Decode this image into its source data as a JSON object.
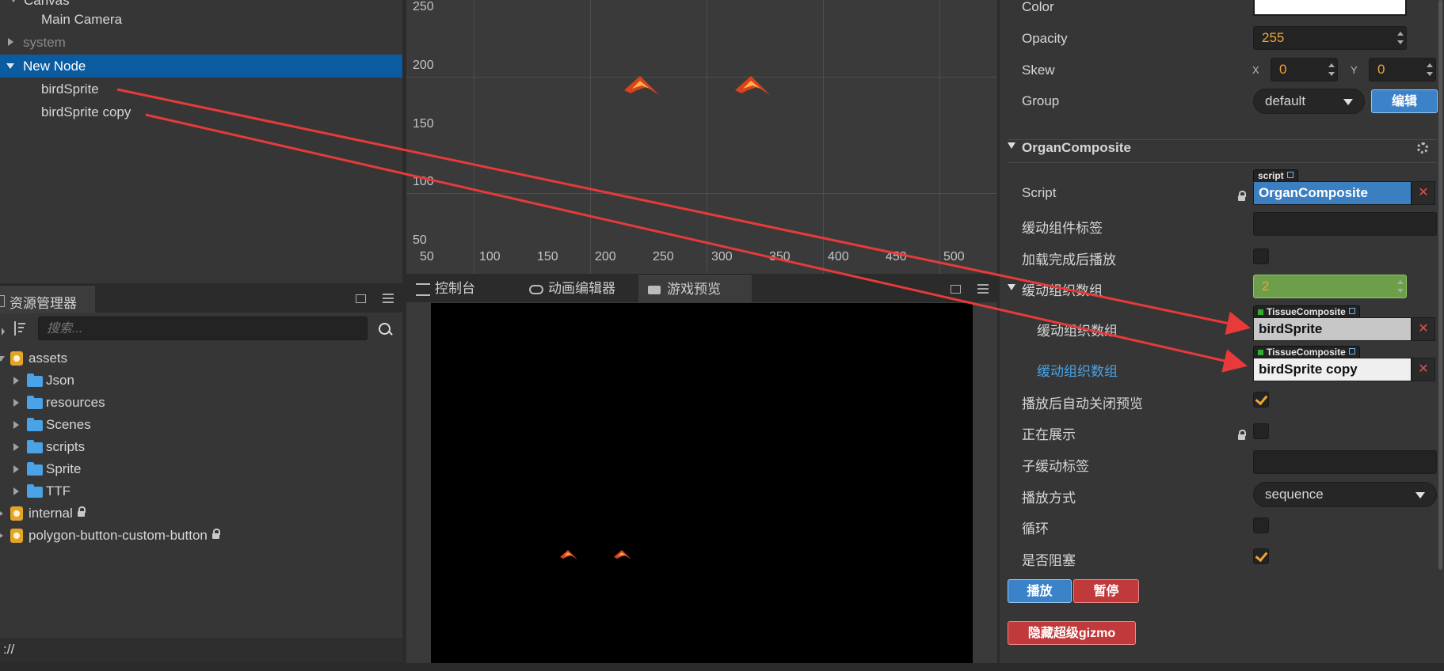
{
  "hierarchy": {
    "items": [
      {
        "label": "Canvas"
      },
      {
        "label": "Main Camera"
      },
      {
        "label": "system"
      },
      {
        "label": "New Node"
      },
      {
        "label": "birdSprite"
      },
      {
        "label": "birdSprite copy"
      }
    ]
  },
  "assets": {
    "tab_label": "资源管理器",
    "search_placeholder": "搜索...",
    "tree": [
      {
        "label": "assets"
      },
      {
        "label": "Json"
      },
      {
        "label": "resources"
      },
      {
        "label": "Scenes"
      },
      {
        "label": "scripts"
      },
      {
        "label": "Sprite"
      },
      {
        "label": "TTF"
      },
      {
        "label": "internal"
      },
      {
        "label": "polygon-button-custom-button"
      }
    ],
    "status": "://"
  },
  "scene": {
    "y_ticks": [
      "250",
      "200",
      "150",
      "100",
      "50"
    ],
    "x_ticks": [
      "50",
      "100",
      "150",
      "200",
      "250",
      "300",
      "350",
      "400",
      "450",
      "500"
    ]
  },
  "bottom_tabs": {
    "console": "控制台",
    "anim_editor": "动画编辑器",
    "game_preview": "游戏预览"
  },
  "inspector": {
    "color_label": "Color",
    "opacity_label": "Opacity",
    "opacity_value": "255",
    "skew_label": "Skew",
    "skew_x_label": "X",
    "skew_x": "0",
    "skew_y_label": "Y",
    "skew_y": "0",
    "group_label": "Group",
    "group_value": "default",
    "group_edit": "编辑",
    "component_title": "OrganComposite",
    "script_tag": "script",
    "script_label": "Script",
    "script_value": "OrganComposite",
    "props": {
      "tween_tag_label": "缓动组件标签",
      "autoplay_label": "加载完成后播放",
      "array_label": "缓动组织数组",
      "array_count": "2",
      "elem1_label": "缓动组织数组",
      "elem1_tag": "TissueComposite",
      "elem1_value": "birdSprite",
      "elem2_label": "缓动组织数组",
      "elem2_tag": "TissueComposite",
      "elem2_value": "birdSprite copy",
      "autoclose_label": "播放后自动关闭预览",
      "showing_label": "正在展示",
      "child_tag_label": "子缓动标签",
      "play_mode_label": "播放方式",
      "play_mode_value": "sequence",
      "loop_label": "循环",
      "block_label": "是否阻塞"
    },
    "buttons": {
      "play": "播放",
      "pause": "暂停",
      "hide_gizmo": "隐藏超级gizmo"
    }
  },
  "colors": {
    "selection": "#0a5b9f",
    "accent_orange": "#f0a434",
    "button_blue": "#3b82c9",
    "button_red": "#c0393b",
    "annotation_arrow": "#e83a3a"
  }
}
